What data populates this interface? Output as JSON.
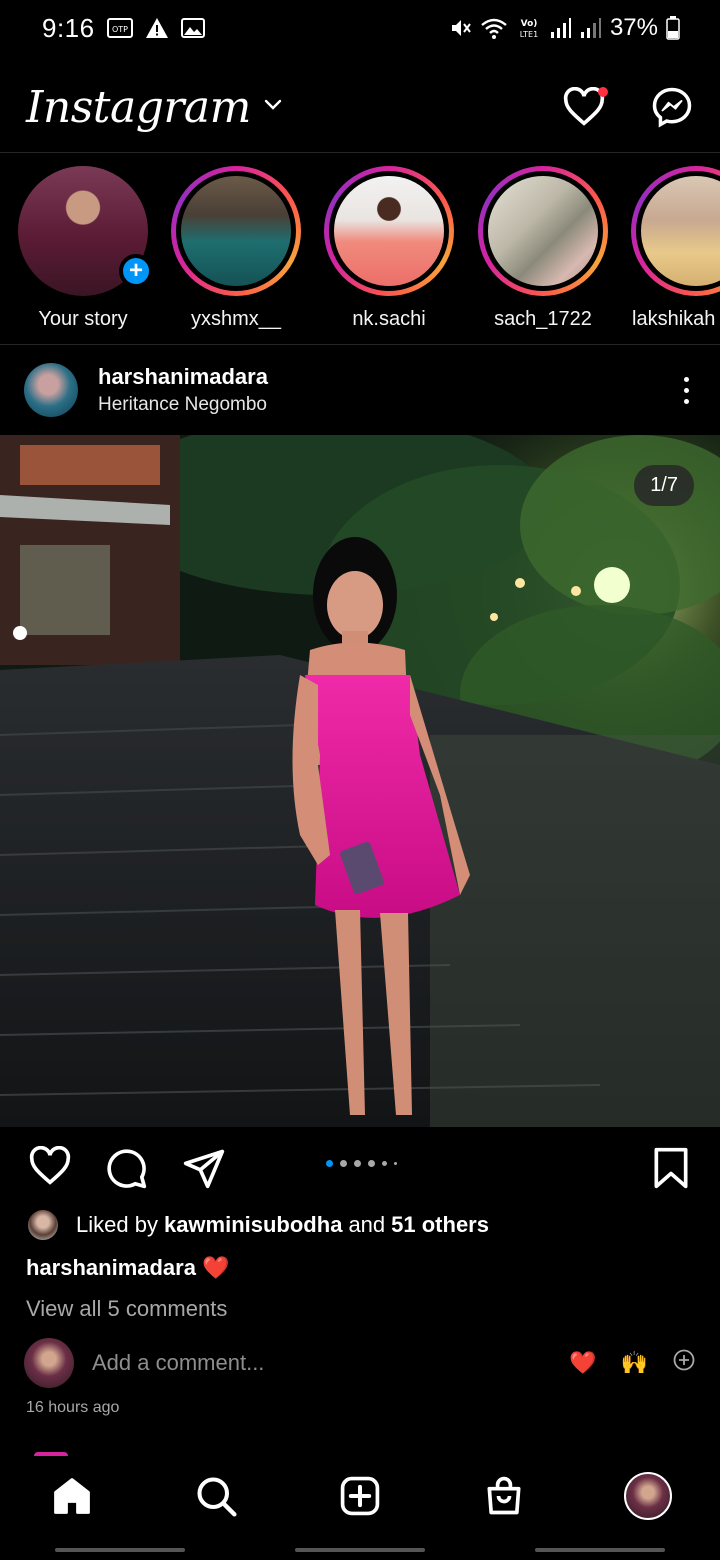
{
  "status_bar": {
    "time": "9:16",
    "battery": "37%",
    "icons": [
      "otp-icon",
      "warning-icon",
      "image-icon",
      "mute-icon",
      "wifi-icon",
      "volte-icon",
      "signal-icon",
      "signal-icon",
      "battery-icon"
    ]
  },
  "header": {
    "logo": "Instagram",
    "has_notification": true
  },
  "stories": [
    {
      "label": "Your story",
      "own": true
    },
    {
      "label": "yxshmx__",
      "own": false
    },
    {
      "label": "nk.sachi",
      "own": false
    },
    {
      "label": "sach_1722",
      "own": false
    },
    {
      "label": "lakshikah",
      "own": false
    }
  ],
  "post": {
    "username": "harshanimadara",
    "location": "Heritance Negombo",
    "counter": "1/7",
    "liked_by_prefix": "Liked by ",
    "liked_by_user": "kawminisubodha",
    "liked_by_middle": " and ",
    "liked_by_others": "51 others",
    "caption_user": "harshanimadara",
    "caption_emoji": "❤️",
    "view_comments": "View all 5 comments",
    "comment_placeholder": "Add a comment...",
    "quick_reactions": [
      "❤️",
      "🙌"
    ],
    "time_ago": "16 hours ago"
  },
  "colors": {
    "accent_blue": "#0095f6",
    "notification_red": "#ff3040",
    "dress_pink": "#e0189a"
  },
  "bottom_nav": [
    "home-icon",
    "search-icon",
    "create-icon",
    "shop-icon",
    "profile-avatar"
  ]
}
